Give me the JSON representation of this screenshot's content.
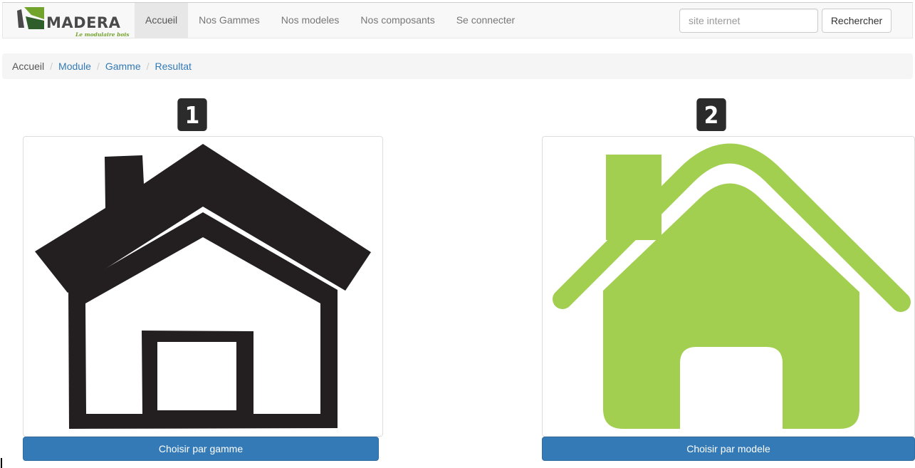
{
  "header": {
    "brand_name": "MADERA",
    "brand_tagline": "Le modulaire bois",
    "nav_items": [
      {
        "label": "Accueil",
        "active": true
      },
      {
        "label": "Nos Gammes"
      },
      {
        "label": "Nos modeles"
      },
      {
        "label": "Nos composants"
      },
      {
        "label": "Se connecter"
      }
    ],
    "search_placeholder": "site internet",
    "search_button": "Rechercher"
  },
  "breadcrumb": [
    "Accueil",
    "Module",
    "Gamme",
    "Resultat"
  ],
  "options": [
    {
      "number": "1",
      "button_label": "Choisir par gamme",
      "icon": "house-outline-icon"
    },
    {
      "number": "2",
      "button_label": "Choisir par modele",
      "icon": "house-solid-icon"
    }
  ],
  "colors": {
    "primary": "#337ab7",
    "brand_green": "#72a32c",
    "house_green": "#a2cf50",
    "house_dark": "#231f20",
    "navbar_bg": "#f8f8f8",
    "badge_bg": "#2b2b2b"
  }
}
